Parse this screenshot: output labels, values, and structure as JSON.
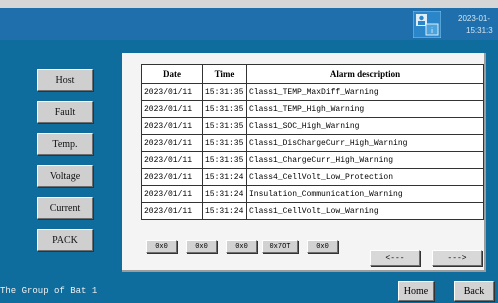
{
  "header": {
    "date": "2023-01-",
    "time": "15:31:3",
    "icon": "user-badge-icon",
    "accent": "#1e6fab"
  },
  "nav": [
    {
      "label": "Host"
    },
    {
      "label": "Fault"
    },
    {
      "label": "Temp."
    },
    {
      "label": "Voltage"
    },
    {
      "label": "Current"
    },
    {
      "label": "PACK"
    }
  ],
  "table": {
    "headers": [
      "Date",
      "Time",
      "Alarm description"
    ],
    "rows": [
      [
        "2023/01/11",
        "15:31:35",
        "Class1_TEMP_MaxDiff_Warning"
      ],
      [
        "2023/01/11",
        "15:31:35",
        "Class1_TEMP_High_Warning"
      ],
      [
        "2023/01/11",
        "15:31:35",
        "Class1_SOC_High_Warning"
      ],
      [
        "2023/01/11",
        "15:31:35",
        "Class1_DisChargeCurr_High_Warning"
      ],
      [
        "2023/01/11",
        "15:31:35",
        "Class1_ChargeCurr_High_Warning"
      ],
      [
        "2023/01/11",
        "15:31:24",
        "Class4_CellVolt_Low_Protection"
      ],
      [
        "2023/01/11",
        "15:31:24",
        "Insulation_Communication_Warning"
      ],
      [
        "2023/01/11",
        "15:31:24",
        "Class1_CellVolt_Low_Warning"
      ]
    ]
  },
  "codes": [
    "0x0",
    "0x0",
    "0x0",
    "0x7OT",
    "0x0"
  ],
  "pager": {
    "prev": "<---",
    "next": "--->"
  },
  "footer": {
    "text": "The Group of Bat 1",
    "home": "Home",
    "back": "Back"
  }
}
